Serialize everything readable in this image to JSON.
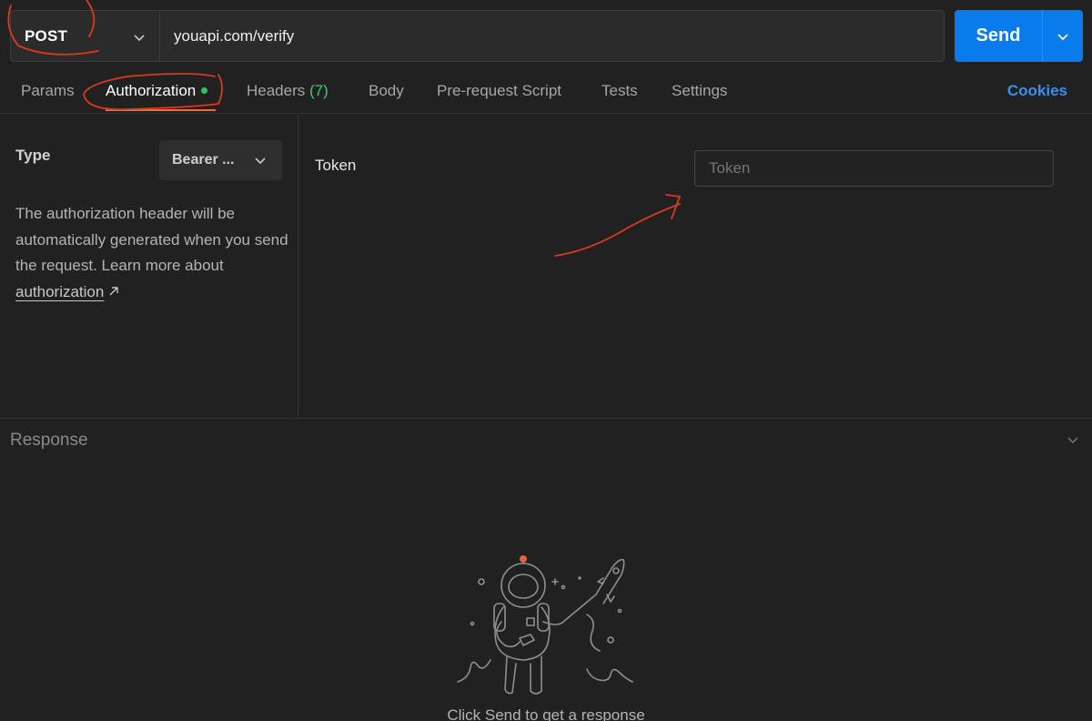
{
  "request": {
    "method": "POST",
    "url": "youapi.com/verify",
    "send_label": "Send"
  },
  "tabs": [
    {
      "label": "Params"
    },
    {
      "label": "Authorization",
      "active": true
    },
    {
      "label": "Headers",
      "count": "(7)"
    },
    {
      "label": "Body"
    },
    {
      "label": "Pre-request Script"
    },
    {
      "label": "Tests"
    },
    {
      "label": "Settings"
    }
  ],
  "cookies_label": "Cookies",
  "auth": {
    "type_label": "Type",
    "type_value": "Bearer ...",
    "help_text": "The authorization header will be automatically generated when you send the request. Learn more about ",
    "help_link": "authorization",
    "token_label": "Token",
    "token_placeholder": "Token"
  },
  "response": {
    "title": "Response",
    "empty_message": "Click Send to get a response"
  },
  "colors": {
    "background": "#212121",
    "send_button": "#097bed",
    "active_tab_underline": "#f26b3a",
    "auth_dot": "#2ec55f",
    "headers_count": "#45c875",
    "cookies_link": "#3d8fe8",
    "annotation": "#d93a1c"
  },
  "icons": [
    "chevron-down-icon",
    "external-link-icon",
    "astronaut-illustration"
  ]
}
